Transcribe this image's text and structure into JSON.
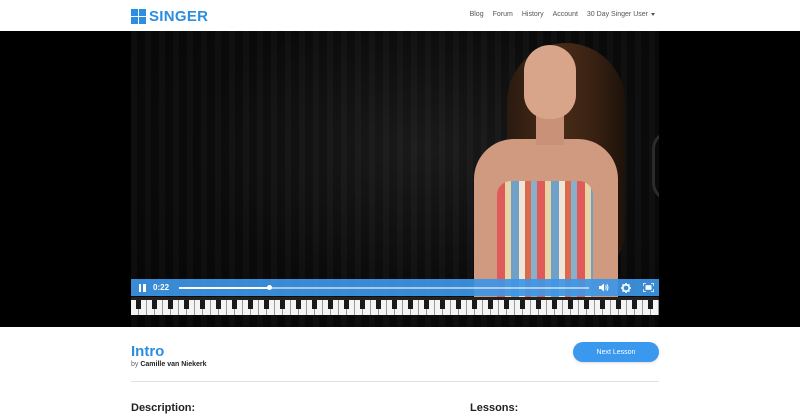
{
  "header": {
    "logo_text": "SINGER",
    "brand_color": "#2d8de0",
    "nav": {
      "blog": "Blog",
      "forum": "Forum",
      "history": "History",
      "account": "Account",
      "user": "30 Day Singer User"
    }
  },
  "player": {
    "time": "0:22",
    "progress": 0.22,
    "accent_color": "#3e96e6",
    "icons": [
      "pause-icon",
      "volume-icon",
      "settings-icon",
      "fullscreen-icon"
    ]
  },
  "lesson": {
    "title": "Intro",
    "by_prefix": "by",
    "author": "Camille van Niekerk",
    "next_button": "Next Lesson"
  },
  "sections": {
    "description": "Description:",
    "lessons": "Lessons:"
  }
}
